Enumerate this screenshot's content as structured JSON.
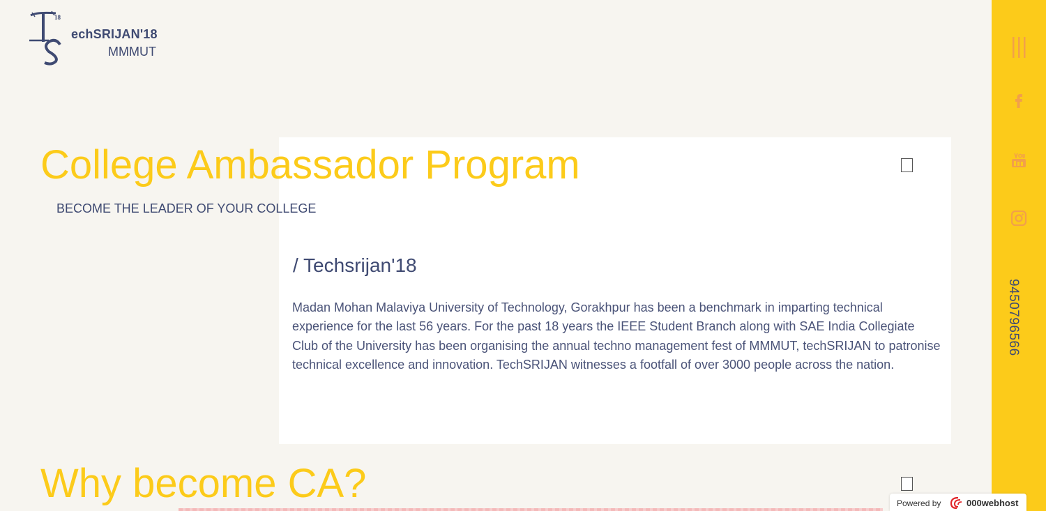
{
  "logo": {
    "superscript": "18",
    "title": "echSRIJAN'18",
    "subtitle": "MMMUT"
  },
  "hero": {
    "title": "College Ambassador Program",
    "subtitle": "BECOME THE LEADER OF YOUR COLLEGE"
  },
  "about": {
    "heading": "/ Techsrijan'18",
    "body": "Madan Mohan Malaviya University of Technology, Gorakhpur has been a benchmark in imparting technical experience for the last 56 years. For the past 18 years the IEEE Student Branch along with SAE India Collegiate Club of the University has been organising the annual techno management fest of MMMUT, techSRIJAN to patronise technical excellence and innovation. TechSRIJAN witnesses a footfall of over 3000 people across the nation."
  },
  "why": {
    "title": "Why become CA?"
  },
  "sidebar": {
    "icons": [
      "menu-icon",
      "facebook-icon",
      "youtube-icon",
      "instagram-icon"
    ],
    "phone": "9450796566"
  },
  "powered": {
    "label": "Powered by",
    "brand": "000webhost"
  },
  "colors": {
    "accent": "#fccb1a",
    "text": "#3f4a72",
    "background": "#f7f5f0",
    "icon": "#f2a04a"
  }
}
